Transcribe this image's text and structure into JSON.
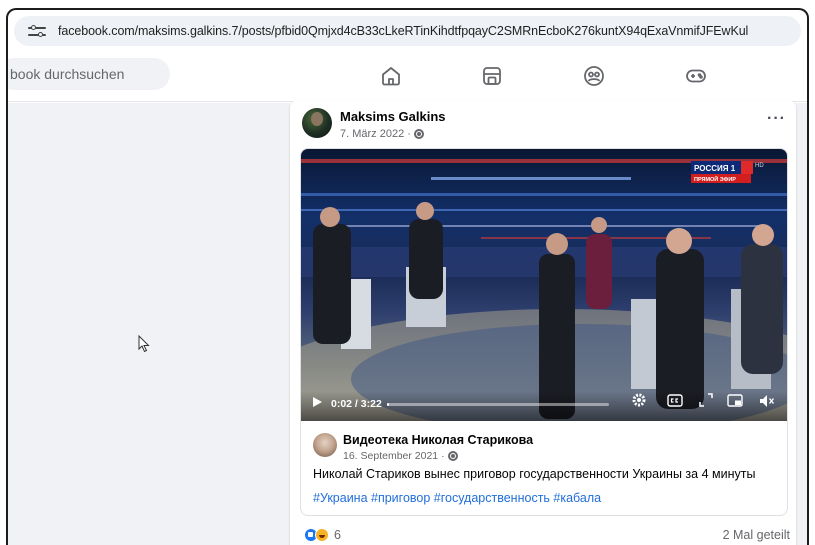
{
  "browser": {
    "url": "facebook.com/maksims.galkins.7/posts/pfbid0Qmjxd4cB33cLkeRTinKihdtfpqayC2SMRnEcboK276kuntX94qExaVnmifJFEwKul"
  },
  "fb_nav": {
    "search_placeholder": "book durchsuchen",
    "icons": [
      "home-icon",
      "marketplace-icon",
      "groups-icon",
      "gaming-icon"
    ]
  },
  "post": {
    "author": "Maksims Galkins",
    "date": "7. März 2022 ·",
    "more_label": "···",
    "video": {
      "channel_label": "РОССИЯ 1",
      "channel_sub": "ПРЯМОЙ ЭФИР",
      "hd_label": "HD",
      "time": "0:02 / 3:22",
      "progress": 0.01
    },
    "shared": {
      "author": "Видеотека Николая Старикова",
      "date": "16. September 2021 ·",
      "text": "Николай Стариков вынес приговор государственности Украины за 4 минуты",
      "tags": "#Украина #приговор #государственность #кабала"
    },
    "reactions_count": "6",
    "shares": "2 Mal geteilt"
  },
  "colors": {
    "link": "#216fdb",
    "like_blue": "#1877f2",
    "haha_yellow": "#f7b125",
    "feed_bg": "#f0f2f5"
  }
}
